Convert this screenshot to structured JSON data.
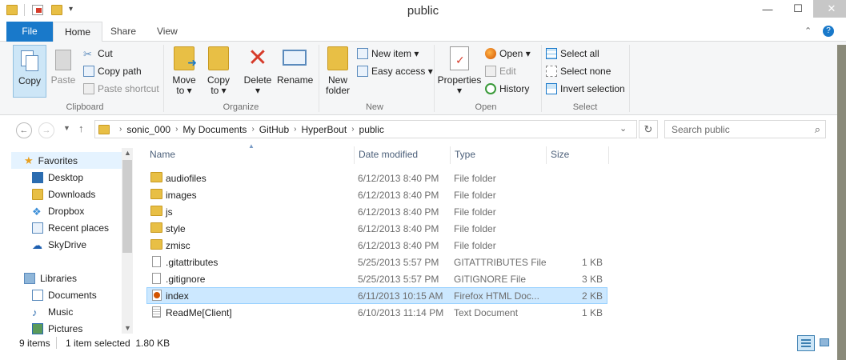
{
  "window": {
    "title": "public",
    "minimize": "—",
    "maximize": "☐",
    "close": "✕"
  },
  "ribbon_tabs": [
    {
      "id": "file",
      "label": "File"
    },
    {
      "id": "home",
      "label": "Home"
    },
    {
      "id": "share",
      "label": "Share"
    },
    {
      "id": "view",
      "label": "View"
    }
  ],
  "ribbon": {
    "clipboard": {
      "label": "Clipboard",
      "copy": "Copy",
      "paste": "Paste",
      "cut": "Cut",
      "copy_path": "Copy path",
      "paste_shortcut": "Paste shortcut"
    },
    "organize": {
      "label": "Organize",
      "move_to": "Move",
      "move_to2": "to ▾",
      "copy_to": "Copy",
      "copy_to2": "to ▾",
      "delete": "Delete",
      "delete2": "▾",
      "rename": "Rename"
    },
    "new": {
      "label": "New",
      "new_folder": "New",
      "new_folder2": "folder",
      "new_item": "New item ▾",
      "easy_access": "Easy access ▾"
    },
    "open": {
      "label": "Open",
      "properties": "Properties",
      "properties2": "▾",
      "open": "Open ▾",
      "edit": "Edit",
      "history": "History"
    },
    "select": {
      "label": "Select",
      "select_all": "Select all",
      "select_none": "Select none",
      "invert": "Invert selection"
    }
  },
  "address": {
    "breadcrumbs": [
      "sonic_000",
      "My Documents",
      "GitHub",
      "HyperBout",
      "public"
    ],
    "search_placeholder": "Search public"
  },
  "nav_pane": {
    "favorites": "Favorites",
    "favorites_items": [
      "Desktop",
      "Downloads",
      "Dropbox",
      "Recent places",
      "SkyDrive"
    ],
    "libraries": "Libraries",
    "libraries_items": [
      "Documents",
      "Music",
      "Pictures"
    ]
  },
  "columns": {
    "name": "Name",
    "date": "Date modified",
    "type": "Type",
    "size": "Size"
  },
  "files": [
    {
      "name": "audiofiles",
      "date": "6/12/2013 8:40 PM",
      "type": "File folder",
      "size": "",
      "kind": "folder"
    },
    {
      "name": "images",
      "date": "6/12/2013 8:40 PM",
      "type": "File folder",
      "size": "",
      "kind": "folder"
    },
    {
      "name": "js",
      "date": "6/12/2013 8:40 PM",
      "type": "File folder",
      "size": "",
      "kind": "folder"
    },
    {
      "name": "style",
      "date": "6/12/2013 8:40 PM",
      "type": "File folder",
      "size": "",
      "kind": "folder"
    },
    {
      "name": "zmisc",
      "date": "6/12/2013 8:40 PM",
      "type": "File folder",
      "size": "",
      "kind": "folder"
    },
    {
      "name": ".gitattributes",
      "date": "5/25/2013 5:57 PM",
      "type": "GITATTRIBUTES File",
      "size": "1 KB",
      "kind": "file"
    },
    {
      "name": ".gitignore",
      "date": "5/25/2013 5:57 PM",
      "type": "GITIGNORE File",
      "size": "3 KB",
      "kind": "file"
    },
    {
      "name": "index",
      "date": "6/11/2013 10:15 AM",
      "type": "Firefox HTML Doc...",
      "size": "2 KB",
      "kind": "html",
      "selected": true
    },
    {
      "name": "ReadMe[Client]",
      "date": "6/10/2013 11:14 PM",
      "type": "Text Document",
      "size": "1 KB",
      "kind": "text"
    }
  ],
  "status": {
    "count": "9 items",
    "selection": "1 item selected  1.80 KB"
  },
  "colors": {
    "accent": "#1979ca",
    "selection": "#cce8ff",
    "folder": "#e8bf45"
  }
}
